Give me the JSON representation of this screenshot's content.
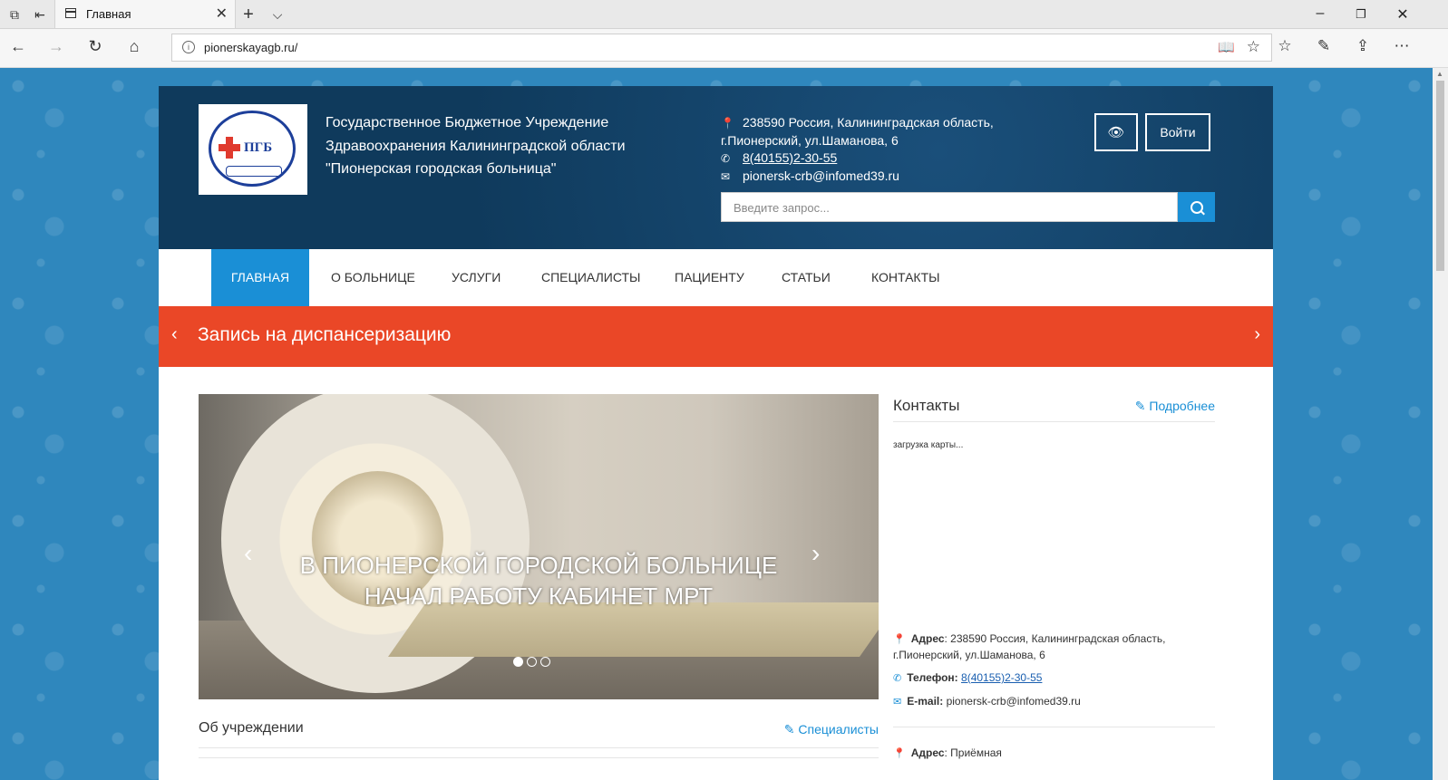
{
  "browser": {
    "tab_title": "Главная",
    "url": "pionerskayagb.ru/"
  },
  "site": {
    "org_name": [
      "Государственное Бюджетное Учреждение",
      "Здравоохранения Калининградской области",
      "\"Пионерская городская больница\""
    ],
    "logo_text": "ПГБ",
    "address_line1": "238590 Россия, Калининградская область,",
    "address_line2": "г.Пионерский, ул.Шаманова, 6",
    "phone": "8(40155)2-30-55",
    "email": "pionersk-crb@infomed39.ru",
    "login_label": "Войти",
    "search_placeholder": "Введите запрос...",
    "menu": [
      "Главная",
      "О больнице",
      "Услуги",
      "Специалисты",
      "Пациенту",
      "Статьи",
      "Контакты"
    ],
    "banner_text": "Запись на диспансеризацию",
    "slider_caption": "В Пионерской городской больнице начал работу кабинет МРТ",
    "about_title": "Об учреждении",
    "about_link": "Специалисты",
    "contacts_title": "Контакты",
    "contacts_link": "Подробнее",
    "map_loading": "загрузка карты...",
    "address_label": "Адрес",
    "address_full_1": ": 238590 Россия, Калининградская область,",
    "address_full_2": "г.Пионерский, ул.Шаманова, 6",
    "phone_label": "Телефон:",
    "email_label": "E-mail:",
    "address2_label": "Адрес",
    "address2_value": ": Приёмная"
  }
}
